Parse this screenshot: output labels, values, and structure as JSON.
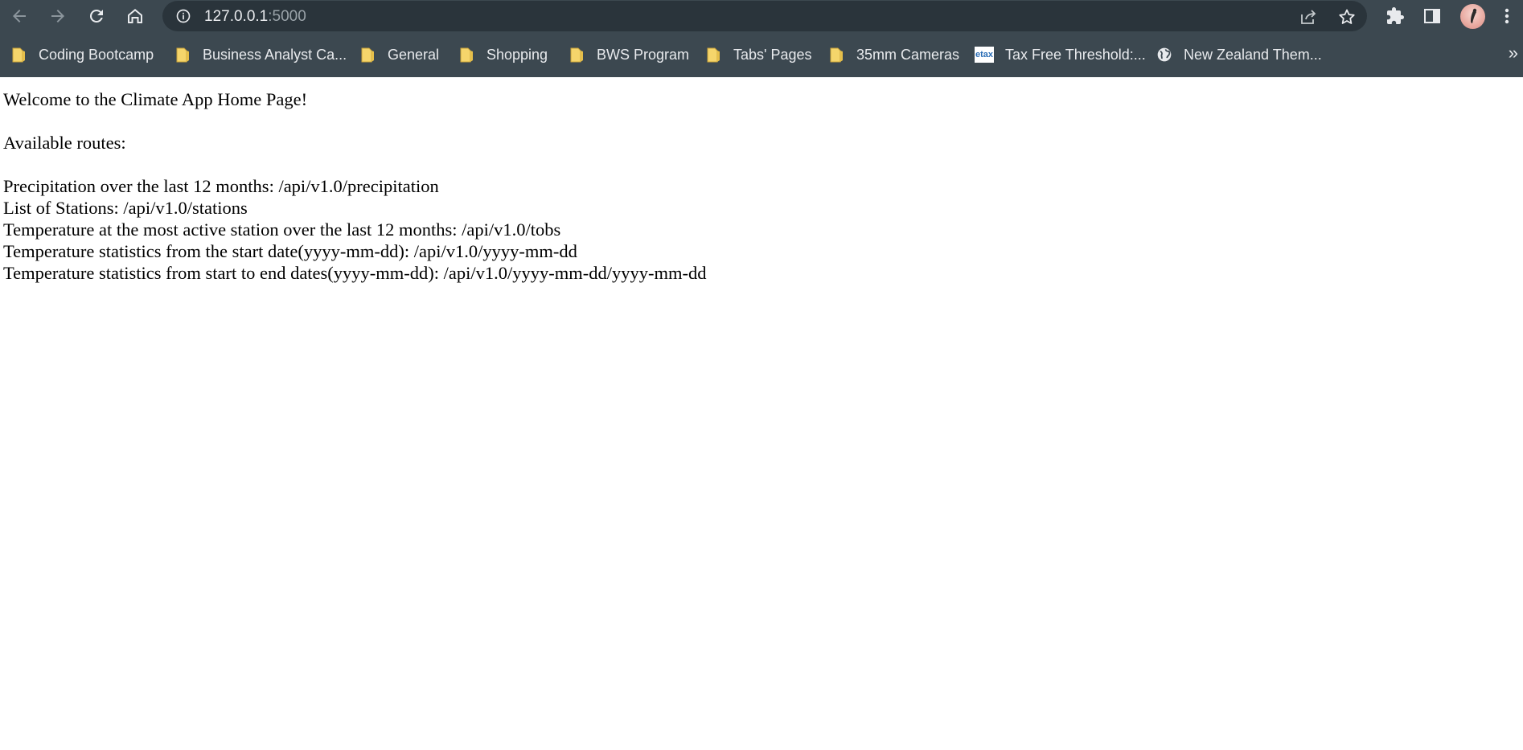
{
  "browser": {
    "url_host": "127.0.0.1",
    "url_port": ":5000",
    "bookmarks": [
      {
        "label": "Coding Bootcamp",
        "icon": "folder-icon"
      },
      {
        "label": "Business Analyst Ca...",
        "icon": "folder-icon"
      },
      {
        "label": "General",
        "icon": "folder-icon"
      },
      {
        "label": "Shopping",
        "icon": "folder-icon"
      },
      {
        "label": "BWS Program",
        "icon": "folder-icon"
      },
      {
        "label": "Tabs' Pages",
        "icon": "folder-icon"
      },
      {
        "label": "35mm Cameras",
        "icon": "folder-icon"
      },
      {
        "label": "Tax Free Threshold:...",
        "icon": "etax-favicon"
      },
      {
        "label": "New Zealand Them...",
        "icon": "globe-icon"
      }
    ],
    "etax_logo_text": "etax",
    "overflow": "»",
    "colors": {
      "chrome_bg": "#3c4850",
      "omnibox_bg": "#2a343b",
      "folder_yellow": "#f5d56b"
    }
  },
  "page": {
    "heading": "Welcome to the Climate App Home Page!",
    "routes_title": "Available routes:",
    "routes": [
      "Precipitation over the last 12 months: /api/v1.0/precipitation",
      "List of Stations: /api/v1.0/stations",
      "Temperature at the most active station over the last 12 months: /api/v1.0/tobs",
      "Temperature statistics from the start date(yyyy-mm-dd): /api/v1.0/yyyy-mm-dd",
      "Temperature statistics from start to end dates(yyyy-mm-dd): /api/v1.0/yyyy-mm-dd/yyyy-mm-dd"
    ]
  }
}
